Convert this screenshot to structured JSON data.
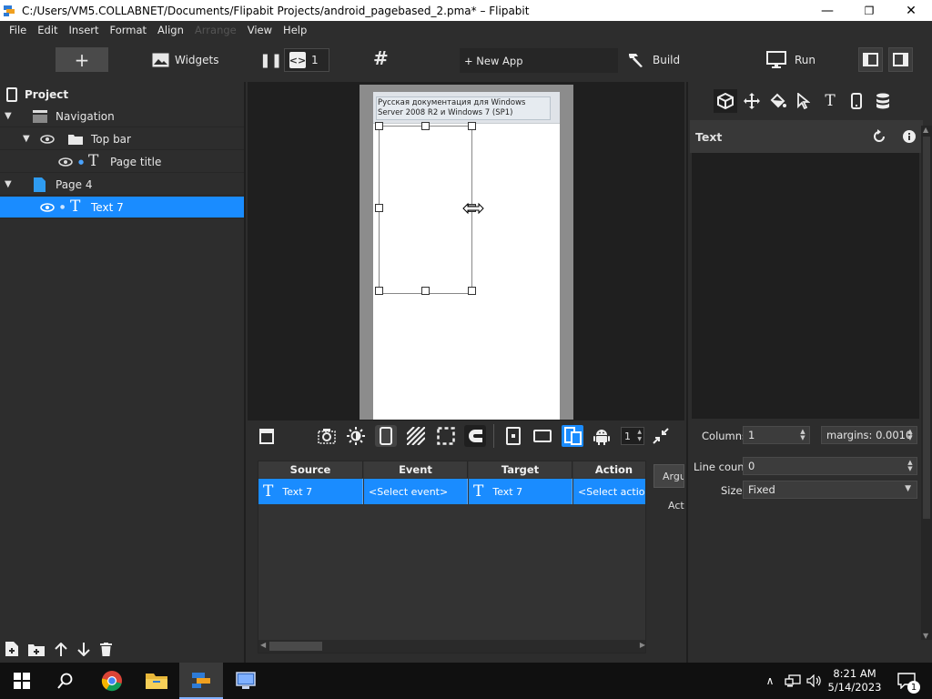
{
  "window": {
    "title": "C:/Users/VM5.COLLABNET/Documents/Flipabit Projects/android_pagebased_2.pma* – Flipabit",
    "minimize": "—",
    "maximize": "❐",
    "close": "✕"
  },
  "menu": [
    "File",
    "Edit",
    "Insert",
    "Format",
    "Align",
    "Arrange",
    "View",
    "Help"
  ],
  "toolbar": {
    "add": "+",
    "widgets": "Widgets",
    "pause": "❚❚",
    "page_count": "1",
    "grid": "#",
    "new_app": "+ New App",
    "build": "Build",
    "run": "Run"
  },
  "project": {
    "heading": "Project",
    "tree": [
      {
        "label": "Navigation"
      },
      {
        "label": "Top bar"
      },
      {
        "label": "Page title"
      },
      {
        "label": "Page 4"
      },
      {
        "label": "Text 7"
      }
    ]
  },
  "canvas": {
    "page_title_text": "Русская документация для Windows Server 2008 R2 и Windows 7 (SP1)",
    "zoom_value": "1"
  },
  "actions": {
    "columns": [
      "Source",
      "Event",
      "Target",
      "Action"
    ],
    "row": {
      "source": "Text 7",
      "event": "<Select event>",
      "target": "Text 7",
      "action": "<Select action>"
    },
    "arguments_tab": "Arguments",
    "actions_label": "Actions"
  },
  "inspector": {
    "title": "Text",
    "columns_label": "Columns",
    "columns_value": "1",
    "margins_value": "margins: 0.0010",
    "line_count_label": "Line count",
    "line_count_value": "0",
    "size_label": "Size",
    "size_value": "Fixed"
  },
  "taskbar": {
    "time": "8:21 AM",
    "date": "5/14/2023",
    "notification_count": "1"
  },
  "colors": {
    "selection": "#1a8cff",
    "panel": "#2d2d2d",
    "dark": "#1f1f1f"
  }
}
